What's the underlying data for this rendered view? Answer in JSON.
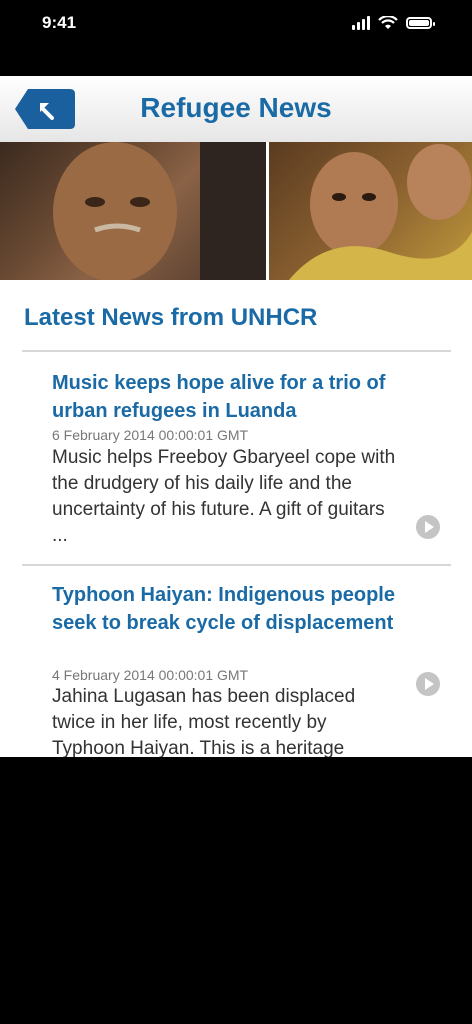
{
  "status": {
    "time": "9:41"
  },
  "navbar": {
    "title": "Refugee News"
  },
  "section": {
    "title": "Latest News from UNHCR"
  },
  "news": [
    {
      "headline": "Music keeps hope alive for a trio of urban refugees in Luanda",
      "date": "6 February 2014 00:00:01 GMT",
      "summary": "Music helps Freeboy Gbaryeel cope with the drudgery of his daily life and the uncertainty of his future. A gift of guitars ..."
    },
    {
      "headline": "Typhoon Haiyan: Indigenous people seek to break cycle of displacement",
      "date": "4 February 2014 00:00:01 GMT",
      "summary": "Jahina Lugasan has been displaced twice in her life, most recently by Typhoon Haiyan. This is a heritage"
    }
  ],
  "colors": {
    "accent": "#1a6aa6",
    "back_button": "#1a5f9e"
  },
  "icons": {
    "back": "back-arrow-icon",
    "row_arrow": "chevron-right-circle-icon"
  }
}
